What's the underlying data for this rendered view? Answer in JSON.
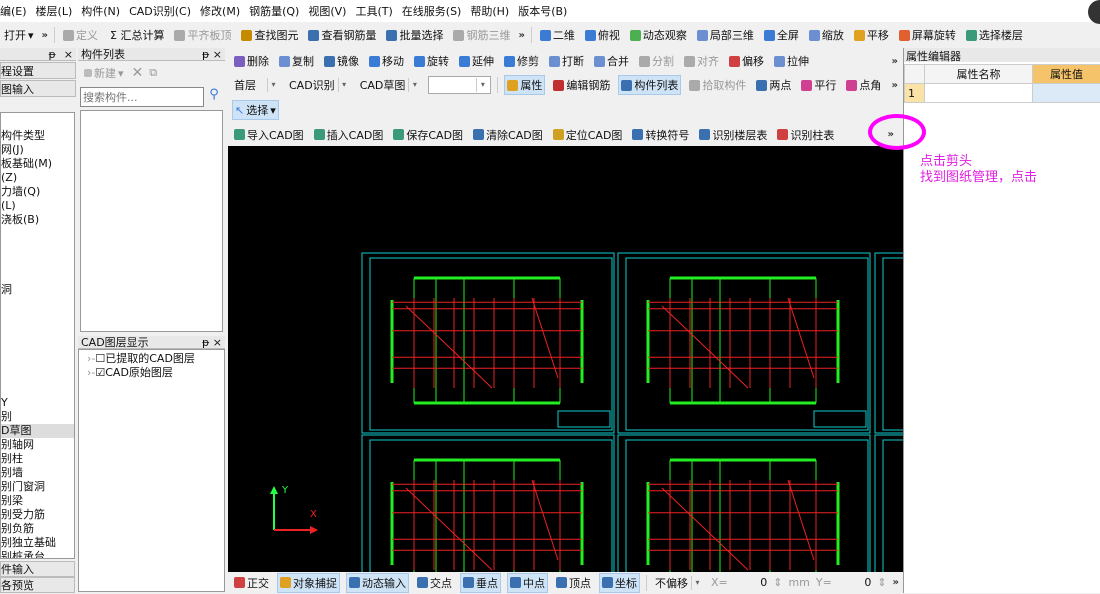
{
  "menu": [
    "编(E)",
    "楼层(L)",
    "构件(N)",
    "CAD识别(C)",
    "修改(M)",
    "钢筋量(Q)",
    "视图(V)",
    "工具(T)",
    "在线服务(S)",
    "帮助(H)",
    "版本号(B)"
  ],
  "toolbar1": {
    "open": "打开",
    "items": [
      {
        "label": "定义",
        "dis": true,
        "c": "#aaa"
      },
      {
        "label": "Σ 汇总计算",
        "c": ""
      },
      {
        "label": "平齐板顶",
        "dis": true,
        "c": "#aaa"
      },
      {
        "label": "查找图元",
        "c": "#c58a00"
      },
      {
        "label": "查看钢筋量",
        "c": "#3a6fb0"
      },
      {
        "label": "批量选择",
        "c": "#3a6fb0"
      },
      {
        "label": "钢筋三维",
        "dis": true,
        "c": "#aaa"
      }
    ],
    "view_items": [
      {
        "label": "二维",
        "c": "#3a7bd5"
      },
      {
        "label": "俯视",
        "c": "#3a7bd5"
      },
      {
        "label": "动态观察",
        "c": "#4caf50"
      },
      {
        "label": "局部三维",
        "c": "#6b8fd0"
      },
      {
        "label": "全屏",
        "c": "#3a7bd5"
      },
      {
        "label": "缩放",
        "c": "#6b8fd0"
      },
      {
        "label": "平移",
        "c": "#e0a020"
      },
      {
        "label": "屏幕旋转",
        "c": "#e06030"
      },
      {
        "label": "选择楼层",
        "c": "#3a9a7a"
      }
    ]
  },
  "left_panel": {
    "items": [
      "程设置",
      "图输入"
    ],
    "tree_top": [
      "构件类型",
      "网(J)",
      "板基础(M)",
      "(Z)",
      "力墙(Q)",
      "(L)",
      "浇板(B)",
      "",
      "",
      "",
      "",
      "洞"
    ],
    "tree_bottom": [
      "Y",
      "别",
      "D草图",
      "别轴网",
      "别柱",
      "别墙",
      "别门窗洞",
      "别梁",
      "别受力筋",
      "别负筋",
      "别独立基础",
      "别桩承台",
      "别桩",
      "别柱大样"
    ],
    "selected": "D草图",
    "footer": [
      "件输入",
      "各预览"
    ]
  },
  "component_list": {
    "title": "构件列表",
    "new_label": "新建",
    "search_placeholder": "搜索构件..."
  },
  "cad_layers": {
    "title": "CAD图层显示",
    "items": [
      {
        "label": "已提取的CAD图层",
        "checked": false
      },
      {
        "label": "CAD原始图层",
        "checked": true
      }
    ]
  },
  "edit_toolbar": [
    {
      "label": "删除",
      "c": "#7a5fc0"
    },
    {
      "label": "复制",
      "c": "#6b8fd0"
    },
    {
      "label": "镜像",
      "c": "#3a6fb0"
    },
    {
      "label": "移动",
      "c": "#3a7bd5"
    },
    {
      "label": "旋转",
      "c": "#3a7bd5"
    },
    {
      "label": "延伸",
      "c": "#3a7bd5"
    },
    {
      "label": "修剪",
      "c": "#3a7bd5"
    },
    {
      "label": "打断",
      "c": "#6b8fd0"
    },
    {
      "label": "合并",
      "c": "#6b8fd0"
    },
    {
      "label": "分割",
      "dis": true,
      "c": "#aaa"
    },
    {
      "label": "对齐",
      "dis": true,
      "c": "#aaa"
    },
    {
      "label": "偏移",
      "c": "#d04040"
    },
    {
      "label": "拉伸",
      "c": "#6b8fd0"
    }
  ],
  "floor_toolbar": {
    "floor": "首层",
    "mode": "CAD识别",
    "type": "CAD草图",
    "blank": "",
    "items": [
      {
        "label": "属性",
        "c": "#e0a020",
        "sel": true
      },
      {
        "label": "编辑钢筋",
        "c": "#c03030"
      },
      {
        "label": "构件列表",
        "c": "#3a6fb0",
        "sel": true
      },
      {
        "label": "拾取构件",
        "dis": true,
        "c": "#aaa"
      },
      {
        "label": "两点",
        "c": "#3a6fb0"
      },
      {
        "label": "平行",
        "c": "#d04090"
      },
      {
        "label": "点角",
        "c": "#d04090"
      }
    ]
  },
  "select_label": "选择",
  "cad_toolbar": [
    {
      "label": "导入CAD图",
      "c": "#3a9a7a"
    },
    {
      "label": "插入CAD图",
      "c": "#3a9a7a"
    },
    {
      "label": "保存CAD图",
      "c": "#3a9a7a"
    },
    {
      "label": "清除CAD图",
      "c": "#3a6fb0"
    },
    {
      "label": "定位CAD图",
      "c": "#d0a020"
    },
    {
      "label": "转换符号",
      "c": "#3a6fb0"
    },
    {
      "label": "识别楼层表",
      "c": "#3a6fb0"
    },
    {
      "label": "识别柱表",
      "c": "#d04040"
    }
  ],
  "status_bar": {
    "items": [
      {
        "label": "正交",
        "c": "#d04040"
      },
      {
        "label": "对象捕捉",
        "c": "#e0a020",
        "sel": true
      },
      {
        "label": "动态输入",
        "c": "#3a6fb0",
        "sel": true
      },
      {
        "label": "交点",
        "c": "#3a6fb0"
      },
      {
        "label": "垂点",
        "c": "#3a6fb0",
        "sel": true
      },
      {
        "label": "中点",
        "c": "#3a6fb0",
        "sel": true
      },
      {
        "label": "顶点",
        "c": "#3a6fb0"
      },
      {
        "label": "坐标",
        "c": "#3a6fb0",
        "sel": true
      }
    ],
    "offset": "不偏移",
    "x_label": "X=",
    "x_value": "0",
    "unit": "mm",
    "y_label": "Y=",
    "y_value": "0"
  },
  "property_editor": {
    "title": "属性编辑器",
    "col_name": "属性名称",
    "col_value": "属性值",
    "row": "1"
  },
  "annotation": {
    "line1": "点击剪头",
    "line2": "找到图纸管理，点击",
    "color": "#e020e0"
  },
  "axis": {
    "x": "X",
    "y": "Y"
  }
}
